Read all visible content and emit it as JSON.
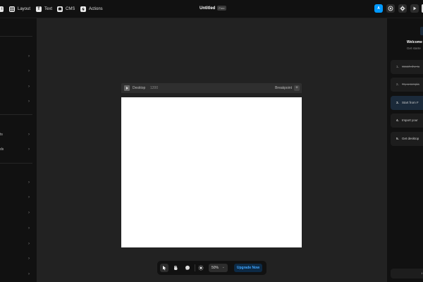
{
  "topbar": {
    "menu_items": [
      {
        "label": "t",
        "icon": "insert-icon"
      },
      {
        "label": "Layout",
        "icon": "layout-icon"
      },
      {
        "label": "Text",
        "icon": "text-icon"
      },
      {
        "label": "CMS",
        "icon": "database-icon"
      },
      {
        "label": "Actions",
        "icon": "bolt-icon"
      }
    ],
    "project_title": "Untitled",
    "project_badge": "Free",
    "avatar_letter": "A",
    "right_icons": [
      "avatar",
      "globe-icon",
      "gear-icon",
      "play-icon"
    ]
  },
  "left_panel": {
    "rows_group1": [
      "",
      "",
      "",
      ""
    ],
    "rows_group2": [
      "ts",
      "ds"
    ],
    "rows_group3": [
      "",
      "",
      "",
      "",
      "",
      "",
      ""
    ]
  },
  "canvas": {
    "frame_name": "Desktop",
    "frame_width": "1200",
    "breakpoint_label": "Breakpoint",
    "add_symbol": "+"
  },
  "right_panel": {
    "title": "Welcome",
    "subtitle": "Get starte",
    "steps": [
      {
        "num": "1.",
        "label": "Watch the tu",
        "done": true
      },
      {
        "num": "2.",
        "label": "Try a templa",
        "done": true
      },
      {
        "num": "3.",
        "label": "Start from F",
        "active": true
      },
      {
        "num": "4.",
        "label": "Import your"
      },
      {
        "num": "5.",
        "label": "Get desktop"
      }
    ],
    "bottom_button": "I"
  },
  "bottom_toolbar": {
    "zoom_value": "50%",
    "upgrade_label": "Upgrade Now",
    "tools": [
      "cursor-icon",
      "hand-icon",
      "comment-icon",
      "sun-icon"
    ]
  },
  "colors": {
    "accent": "#0099ff",
    "upgrade_text": "#41a6ff",
    "bg": "#222222",
    "panel": "#111111"
  }
}
